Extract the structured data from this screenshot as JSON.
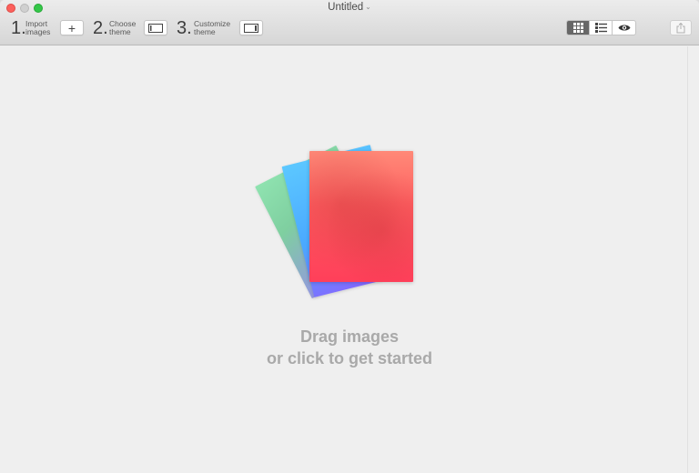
{
  "window": {
    "title": "Untitled"
  },
  "toolbar": {
    "steps": [
      {
        "number": "1.",
        "label_line1": "Import",
        "label_line2": "images",
        "button_icon": "plus-icon",
        "button_glyph": "+"
      },
      {
        "number": "2.",
        "label_line1": "Choose",
        "label_line2": "theme",
        "button_icon": "theme-layout-icon"
      },
      {
        "number": "3.",
        "label_line1": "Customize",
        "label_line2": "theme",
        "button_icon": "sidebar-panel-icon"
      }
    ],
    "view_modes": [
      {
        "name": "grid-view",
        "icon": "grid-icon",
        "active": true
      },
      {
        "name": "list-view",
        "icon": "list-icon",
        "active": false
      },
      {
        "name": "preview",
        "icon": "eye-icon",
        "active": false
      }
    ],
    "share_icon": "share-icon"
  },
  "main": {
    "hint_line1": "Drag images",
    "hint_line2": "or click to get started"
  },
  "colors": {
    "close": "#fc605c",
    "minimize": "#d0d0d0",
    "maximize": "#34c749",
    "hint_text": "#a9a9a9"
  }
}
